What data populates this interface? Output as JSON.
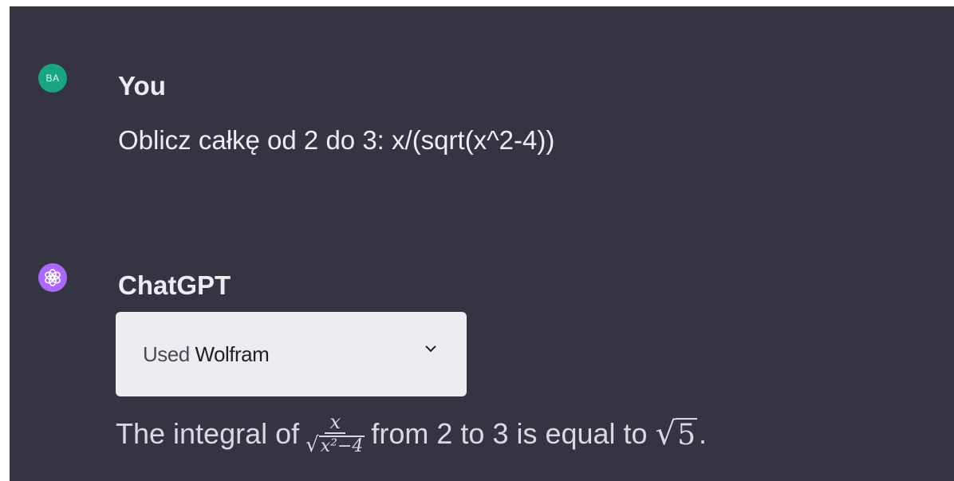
{
  "user_message": {
    "avatar_initials": "BA",
    "author": "You",
    "text": "Oblicz całkę od 2 do 3: x/(sqrt(x^2-4))"
  },
  "assistant_message": {
    "author": "ChatGPT",
    "tool": {
      "used_label": "Used",
      "tool_name": "Wolfram",
      "expand_icon": "chevron-down-icon"
    },
    "answer": {
      "prefix": "The integral of",
      "fraction_numerator": "x",
      "fraction_denominator": "x²−4",
      "middle": "from 2 to 3 is equal to",
      "result_radicand": "5",
      "suffix": "."
    },
    "avatar_icon": "openai-logo-icon"
  },
  "colors": {
    "background": "#343541",
    "user_avatar": "#19a57f",
    "assistant_avatar": "#ab68ff",
    "tool_box": "#ececf1",
    "text": "#ececf1"
  }
}
